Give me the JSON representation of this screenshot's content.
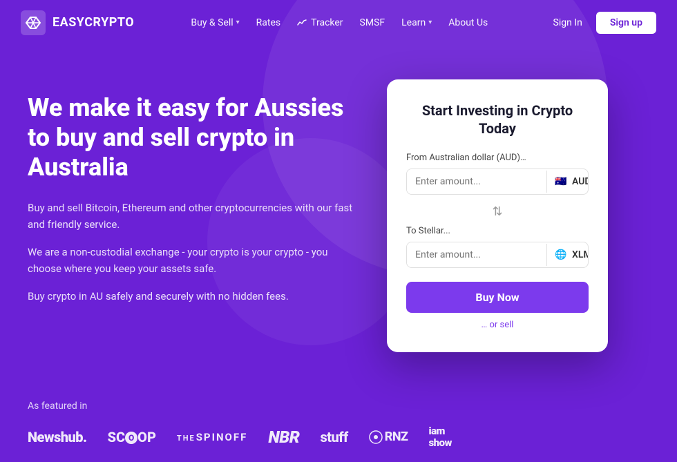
{
  "logo": {
    "icon_alt": "EasyCrypto logo icon",
    "text": "EASYCRYPTO"
  },
  "nav": {
    "items": [
      {
        "label": "Buy & Sell",
        "has_dropdown": true
      },
      {
        "label": "Rates",
        "has_dropdown": false
      },
      {
        "label": "Tracker",
        "has_dropdown": false,
        "has_icon": true
      },
      {
        "label": "SMSF",
        "has_dropdown": false
      },
      {
        "label": "Learn",
        "has_dropdown": true
      },
      {
        "label": "About Us",
        "has_dropdown": false
      }
    ],
    "sign_in": "Sign In",
    "sign_up": "Sign up"
  },
  "hero": {
    "title": "We make it easy for Aussies to buy and sell crypto in Australia",
    "desc1": "Buy and sell Bitcoin, Ethereum and other cryptocurrencies with our fast and friendly service.",
    "desc2": "We are a non-custodial exchange - your crypto is your crypto - you choose where you keep your assets safe.",
    "desc3": "Buy crypto in AU safely and securely with no hidden fees."
  },
  "card": {
    "title": "Start Investing\nin Crypto Today",
    "from_label": "From Australian dollar (AUD)…",
    "from_placeholder": "Enter amount...",
    "from_currency": "AUD",
    "from_flag": "🇦🇺",
    "to_label": "To Stellar...",
    "to_placeholder": "Enter amount...",
    "to_currency": "XLM",
    "to_flag": "🌐",
    "buy_btn": "Buy Now",
    "or_sell": "… or sell"
  },
  "featured": {
    "label": "As featured in",
    "logos": [
      {
        "name": "Newshub",
        "class": "newshub",
        "text": "Newshub."
      },
      {
        "name": "Scoop",
        "class": "scoop",
        "text": "SCOOP"
      },
      {
        "name": "TheSpinoff",
        "class": "spinoff",
        "text": "THESPINOFF"
      },
      {
        "name": "NBR",
        "class": "nbr",
        "text": "NBR"
      },
      {
        "name": "Stuff",
        "class": "stuff",
        "text": "stuff"
      },
      {
        "name": "RNZ",
        "class": "rnz",
        "text": "⊙RNZ"
      },
      {
        "name": "IAmShow",
        "class": "iamshow",
        "text": "iam\nshow"
      }
    ]
  }
}
